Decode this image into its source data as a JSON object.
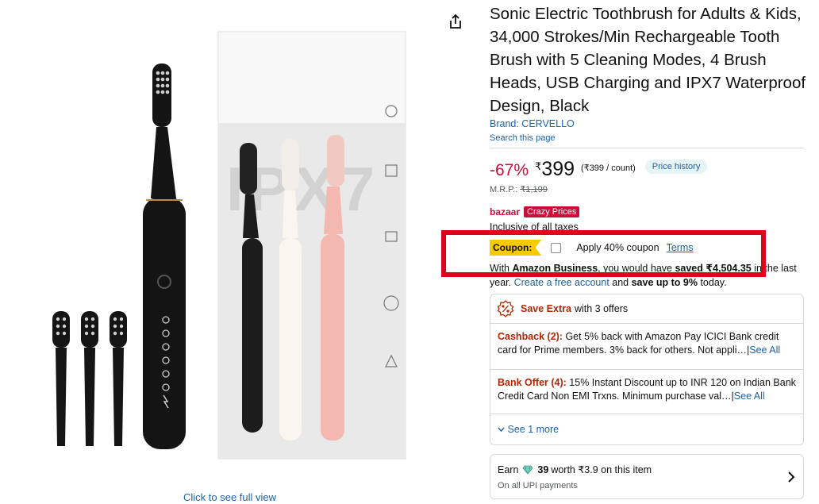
{
  "product": {
    "title": "Sonic Electric Toothbrush for Adults & Kids, 34,000 Strokes/Min Rechargeable Tooth Brush with 5 Cleaning Modes, 4 Brush Heads, USB Charging and IPX7 Waterproof Design, Black",
    "brand": "Brand: CERVELLO",
    "search_page": "Search this page",
    "zoom_link": "Click to see full view",
    "box_text": "IPX7"
  },
  "price": {
    "discount": "-67%",
    "currency": "₹",
    "amount": "399",
    "unit_price": "(₹399 / count)",
    "history_label": "Price history",
    "mrp_label": "M.R.P.:",
    "mrp_value": "₹1,199"
  },
  "bazaar": {
    "logo": "bazaar",
    "tag": "Crazy Prices"
  },
  "taxes": "Inclusive of all taxes",
  "coupon": {
    "badge": "Coupon:",
    "text": "Apply 40% coupon",
    "terms": "Terms",
    "checked": false
  },
  "business": {
    "p1": "With ",
    "b1": "Amazon Business",
    "p2": ", you would have ",
    "b2": "saved ₹4,504.35",
    "p3": " in the last year. ",
    "link": "Create a free account",
    "p4": " and ",
    "b3": "save up to 9%",
    "p5": " today."
  },
  "offers": {
    "header_bold": "Save Extra",
    "header_rest": "with 3 offers",
    "items": [
      {
        "kind": "Cashback (2):",
        "text": " Get 5% back with Amazon Pay ICICI Bank credit card for Prime members. 3% back for others. Not appli…",
        "see_all": "See All"
      },
      {
        "kind": "Bank Offer (4):",
        "text": " 15% Instant Discount up to INR 120 on Indian Bank Credit Card Non EMI Trxns. Minimum purchase val…",
        "see_all": "See All"
      }
    ],
    "see_more": "See 1 more"
  },
  "earn": {
    "prefix": "Earn",
    "points": "39",
    "rest": "worth ₹3.9 on this item",
    "sub": "On all UPI payments"
  },
  "colors": {
    "link": "#2162a1",
    "deal_red": "#cc0c39",
    "offer_red": "#b12704",
    "coupon_yellow": "#f7ca00",
    "highlight": "#e1001a"
  },
  "icons": [
    "share-icon",
    "percent-badge-icon",
    "gem-icon",
    "chevron-down-icon",
    "chevron-right-icon"
  ]
}
